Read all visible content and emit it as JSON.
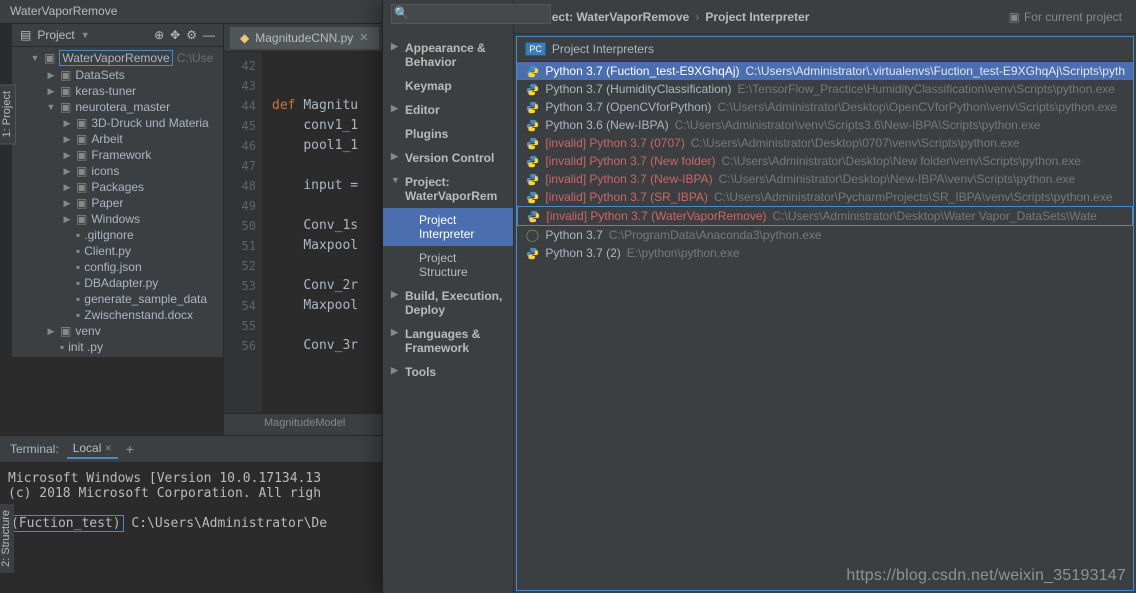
{
  "titlebar": "WaterVaporRemove",
  "sidebar_tab1": "1: Project",
  "sidebar_tab2": "2: Structure",
  "project_panel": {
    "title": "Project",
    "root": "WaterVaporRemove",
    "root_path": "C:\\Use",
    "items": [
      {
        "name": "DataSets",
        "type": "folder",
        "arrow": "▶",
        "indent": 2
      },
      {
        "name": "keras-tuner",
        "type": "folder",
        "arrow": "▶",
        "indent": 2
      },
      {
        "name": "neurotera_master",
        "type": "folder",
        "arrow": "▼",
        "indent": 2
      },
      {
        "name": "3D-Druck und Materia",
        "type": "folder",
        "arrow": "▶",
        "indent": 3
      },
      {
        "name": "Arbeit",
        "type": "folder",
        "arrow": "▶",
        "indent": 3
      },
      {
        "name": "Framework",
        "type": "folder",
        "arrow": "▶",
        "indent": 3
      },
      {
        "name": "icons",
        "type": "folder",
        "arrow": "▶",
        "indent": 3
      },
      {
        "name": "Packages",
        "type": "folder",
        "arrow": "▶",
        "indent": 3
      },
      {
        "name": "Paper",
        "type": "folder",
        "arrow": "▶",
        "indent": 3
      },
      {
        "name": "Windows",
        "type": "folder",
        "arrow": "▶",
        "indent": 3
      },
      {
        "name": ".gitignore",
        "type": "file",
        "arrow": "",
        "indent": 3
      },
      {
        "name": "Client.py",
        "type": "file",
        "arrow": "",
        "indent": 3
      },
      {
        "name": "config.json",
        "type": "file",
        "arrow": "",
        "indent": 3
      },
      {
        "name": "DBAdapter.py",
        "type": "file",
        "arrow": "",
        "indent": 3
      },
      {
        "name": "generate_sample_data",
        "type": "file",
        "arrow": "",
        "indent": 3
      },
      {
        "name": "Zwischenstand.docx",
        "type": "file",
        "arrow": "",
        "indent": 3
      },
      {
        "name": "venv",
        "type": "folder",
        "arrow": "▶",
        "indent": 2
      },
      {
        "name": "init  .py",
        "type": "file",
        "arrow": "",
        "indent": 2
      }
    ]
  },
  "tab": {
    "name": "MagnitudeCNN.py"
  },
  "gutter": [
    "42",
    "43",
    "44",
    "45",
    "46",
    "47",
    "48",
    "49",
    "50",
    "51",
    "52",
    "53",
    "54",
    "55",
    "56"
  ],
  "code": {
    "l44_kw": "def ",
    "l44_name": "Magnitu",
    "l45": "conv1_1",
    "l46": "pool1_1",
    "l48": "input =",
    "l50": "Conv_1s",
    "l51": "Maxpool",
    "l53": "Conv_2r",
    "l54": "Maxpool",
    "l56": "Conv_3r"
  },
  "breadcrumb": "MagnitudeModel",
  "terminal": {
    "label": "Terminal:",
    "tab": "Local",
    "line1": "Microsoft Windows [Version 10.0.17134.13",
    "line2": "(c) 2018 Microsoft Corporation. All righ",
    "env": "(Fuction_test)",
    "path": " C:\\Users\\Administrator\\De"
  },
  "dialog": {
    "search_placeholder": "",
    "nav": [
      {
        "label": "Appearance & Behavior",
        "bold": true,
        "exp": "▶"
      },
      {
        "label": "Keymap",
        "bold": true
      },
      {
        "label": "Editor",
        "bold": true,
        "exp": "▶"
      },
      {
        "label": "Plugins",
        "bold": true
      },
      {
        "label": "Version Control",
        "bold": true,
        "exp": "▶"
      },
      {
        "label": "Project: WaterVaporRem",
        "bold": true,
        "exp": "▼"
      },
      {
        "label": "Project Interpreter",
        "sub": true,
        "selected": true
      },
      {
        "label": "Project Structure",
        "sub": true
      },
      {
        "label": "Build, Execution, Deploy",
        "bold": true,
        "exp": "▶"
      },
      {
        "label": "Languages & Framework",
        "bold": true,
        "exp": "▶"
      },
      {
        "label": "Tools",
        "bold": true,
        "exp": "▶"
      }
    ],
    "crumb1": "Project: WaterVaporRemove",
    "crumb2": "Project Interpreter",
    "for_current": "For current project",
    "panel_title": "Project Interpreters",
    "interpreters": [
      {
        "label": "Python 3.7 (Fuction_test-E9XGhqAj)",
        "path": "C:\\Users\\Administrator\\.virtualenvs\\Fuction_test-E9XGhqAj\\Scripts\\pyth",
        "sel": true
      },
      {
        "label": "Python 3.7 (HumidityClassification)",
        "path": "E:\\TensorFlow_Practice\\HumidityClassification\\venv\\Scripts\\python.exe"
      },
      {
        "label": "Python 3.7 (OpenCVforPython)",
        "path": "C:\\Users\\Administrator\\Desktop\\OpenCVforPython\\venv\\Scripts\\python.exe"
      },
      {
        "label": "Python 3.6 (New-IBPA)",
        "path": "C:\\Users\\Administrator\\venv\\Scripts3.6\\New-IBPA\\Scripts\\python.exe"
      },
      {
        "label": "[invalid] Python 3.7 (0707)",
        "path": "C:\\Users\\Administrator\\Desktop\\0707\\venv\\Scripts\\python.exe",
        "invalid": true
      },
      {
        "label": "[invalid] Python 3.7 (New folder)",
        "path": "C:\\Users\\Administrator\\Desktop\\New folder\\venv\\Scripts\\python.exe",
        "invalid": true
      },
      {
        "label": "[invalid] Python 3.7 (New-IBPA)",
        "path": "C:\\Users\\Administrator\\Desktop\\New-IBPA\\venv\\Scripts\\python.exe",
        "invalid": true
      },
      {
        "label": "[invalid] Python 3.7 (SR_IBPA)",
        "path": "C:\\Users\\Administrator\\PycharmProjects\\SR_IBPA\\venv\\Scripts\\python.exe",
        "invalid": true
      },
      {
        "label": "[invalid] Python 3.7 (WaterVaporRemove)",
        "path": "C:\\Users\\Administrator\\Desktop\\Water Vapor_DataSets\\Wate",
        "invalid": true,
        "frame": true
      },
      {
        "label": "Python 3.7",
        "path": "C:\\ProgramData\\Anaconda3\\python.exe",
        "conda": true
      },
      {
        "label": "Python 3.7 (2)",
        "path": "E:\\python\\python.exe"
      }
    ]
  },
  "watermark": "https://blog.csdn.net/weixin_35193147"
}
